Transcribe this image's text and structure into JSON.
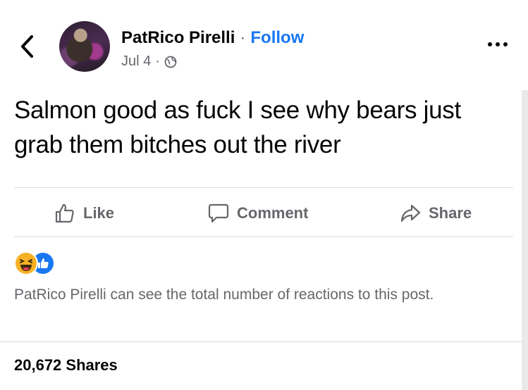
{
  "header": {
    "author": "PatRico Pirelli",
    "separator": "·",
    "follow_label": "Follow",
    "date": "Jul 4",
    "date_separator": "·",
    "privacy_icon": "globe-icon",
    "back_icon": "chevron-left-icon",
    "more_icon": "more-horizontal-icon"
  },
  "post": {
    "text": "Salmon good as fuck I see why bears just grab them bitches out the river"
  },
  "actions": {
    "like_label": "Like",
    "comment_label": "Comment",
    "share_label": "Share"
  },
  "reactions": {
    "icons": [
      "haha-reaction-icon",
      "like-reaction-icon"
    ],
    "notice": "PatRico Pirelli can see the total number of reactions to this post."
  },
  "footer": {
    "shares": "20,672 Shares"
  },
  "colors": {
    "accent": "#1877f2",
    "secondary_text": "#65676b",
    "divider": "#dadde1",
    "haha": "#f7b125"
  }
}
